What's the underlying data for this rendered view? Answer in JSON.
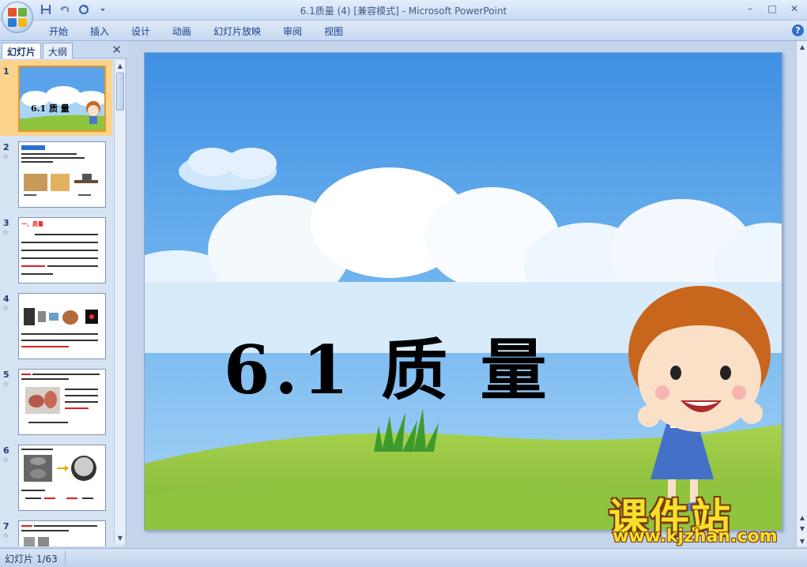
{
  "window": {
    "title": "6.1质量 (4) [兼容模式] - Microsoft PowerPoint",
    "minimize": "–",
    "maximize": "□",
    "close": "✕"
  },
  "ribbon": {
    "tabs": [
      "开始",
      "插入",
      "设计",
      "动画",
      "幻灯片放映",
      "审阅",
      "视图"
    ],
    "help": "?"
  },
  "left_panel": {
    "tabs": [
      "幻灯片",
      "大纲"
    ],
    "close": "✕",
    "slides": [
      {
        "num": "1",
        "title": "6.1 质 量"
      },
      {
        "num": "2"
      },
      {
        "num": "3",
        "title": "一、质量"
      },
      {
        "num": "4"
      },
      {
        "num": "5"
      },
      {
        "num": "6"
      },
      {
        "num": "7"
      }
    ]
  },
  "slide": {
    "title": "6.1 质  量"
  },
  "watermark": {
    "brand": "课件站",
    "url": "www.kjzhan.com"
  },
  "status": {
    "slide_counter": "幻灯片 1/63"
  },
  "colors": {
    "sky_top": "#3f90e4",
    "sky_bottom": "#a9d4f6",
    "grass": "#8fc43e",
    "selected_thumb": "#fbd38a",
    "watermark_yellow": "#f6e12a"
  }
}
